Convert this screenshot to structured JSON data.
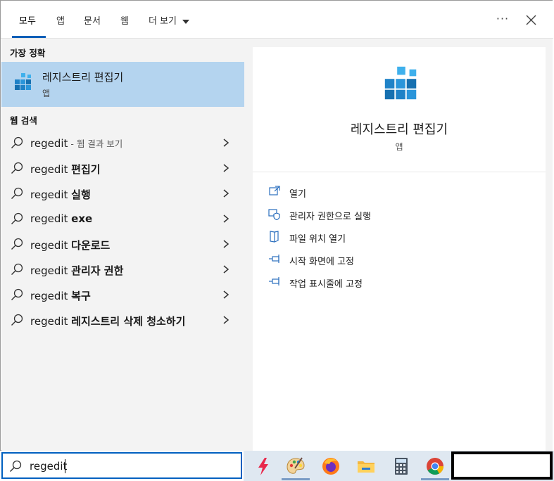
{
  "tabs": [
    {
      "label": "모두",
      "active": true
    },
    {
      "label": "앱"
    },
    {
      "label": "문서"
    },
    {
      "label": "웹"
    },
    {
      "label": "더 보기"
    }
  ],
  "more_menu": "···",
  "accent_color": "#005fb8",
  "best_match": {
    "section_title": "가장 정확",
    "name": "레지스트리 편집기",
    "type": "앱",
    "icon": "registry-editor-icon"
  },
  "web_search": {
    "section_title": "웹 검색",
    "items": [
      {
        "query": "regedit",
        "bold": "",
        "suffix": " - 웹 결과 보기"
      },
      {
        "query": "regedit ",
        "bold": "편집기",
        "suffix": ""
      },
      {
        "query": "regedit ",
        "bold": "실행",
        "suffix": ""
      },
      {
        "query": "regedit ",
        "bold": "exe",
        "suffix": ""
      },
      {
        "query": "regedit ",
        "bold": "다운로드",
        "suffix": ""
      },
      {
        "query": "regedit ",
        "bold": "관리자 권한",
        "suffix": ""
      },
      {
        "query": "regedit ",
        "bold": "복구",
        "suffix": ""
      },
      {
        "query": "regedit ",
        "bold": "레지스트리 삭제 청소하기",
        "suffix": ""
      }
    ]
  },
  "details": {
    "name": "레지스트리 편집기",
    "type": "앱",
    "actions": [
      {
        "label": "열기",
        "icon": "open-icon"
      },
      {
        "label": "관리자 권한으로 실행",
        "icon": "shield-icon"
      },
      {
        "label": "파일 위치 열기",
        "icon": "file-location-icon"
      },
      {
        "label": "시작 화면에 고정",
        "icon": "pin-icon"
      },
      {
        "label": "작업 표시줄에 고정",
        "icon": "pin-icon"
      }
    ]
  },
  "search": {
    "value": "regedit"
  },
  "taskbar": {
    "apps": [
      {
        "name": "lightning-app-icon"
      },
      {
        "name": "paint-palette-icon"
      },
      {
        "name": "firefox-icon"
      },
      {
        "name": "file-explorer-icon"
      },
      {
        "name": "calculator-icon"
      },
      {
        "name": "chrome-icon"
      }
    ]
  }
}
